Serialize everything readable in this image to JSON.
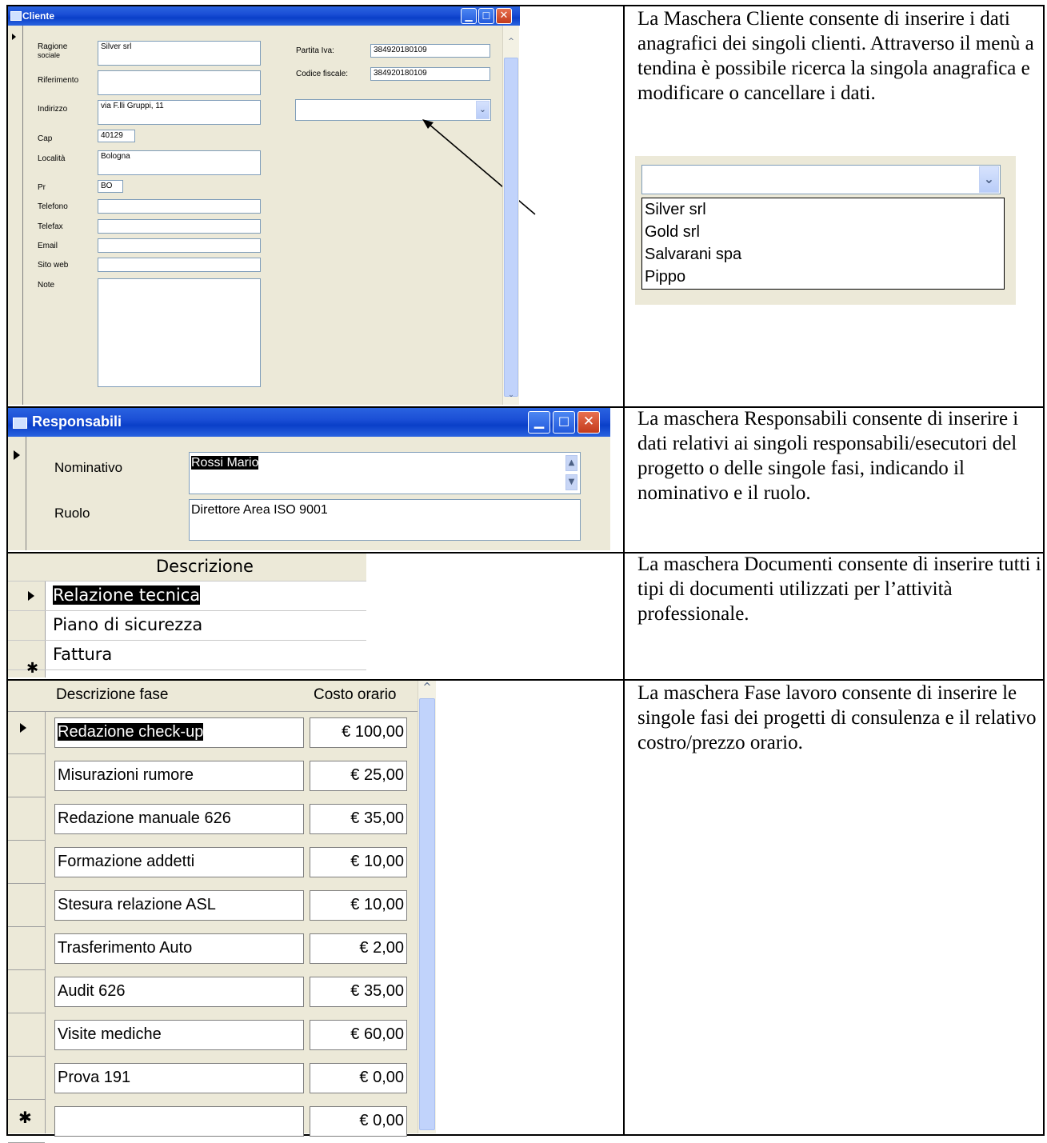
{
  "cliente": {
    "title": "Cliente",
    "labels": {
      "ragione_sociale_1": "Ragione",
      "ragione_sociale_2": "sociale",
      "riferimento": "Riferimento",
      "indirizzo": "Indirizzo",
      "cap": "Cap",
      "localita": "Località",
      "pr": "Pr",
      "telefono": "Telefono",
      "telefax": "Telefax",
      "email": "Email",
      "sito_web": "Sito web",
      "note": "Note",
      "partita_iva": "Partita Iva:",
      "codice_fiscale": "Codice fiscale:"
    },
    "values": {
      "ragione_sociale": "Silver srl",
      "riferimento": "",
      "indirizzo": "via F.lli Gruppi, 11",
      "cap": "40129",
      "localita": "Bologna",
      "pr": "BO",
      "telefono": "",
      "telefax": "",
      "email": "",
      "sito_web": "",
      "note": "",
      "partita_iva": "384920180109",
      "codice_fiscale": "384920180109",
      "search": ""
    },
    "description": "La Maschera Cliente consente di inserire i dati anagrafici dei singoli clienti. Attraverso il menù a tendina è possibile ricerca la singola anagrafica e modificare o cancellare i dati.",
    "dropdown": {
      "value": "",
      "options": [
        "Silver srl",
        "Gold srl",
        "Salvarani spa",
        "Pippo"
      ]
    }
  },
  "responsabili": {
    "title": "Responsabili",
    "labels": {
      "nominativo": "Nominativo",
      "ruolo": "Ruolo"
    },
    "values": {
      "nominativo": "Rossi Mario",
      "ruolo": "Direttore Area ISO 9001"
    },
    "description": "La maschera Responsabili consente di inserire i dati relativi ai singoli responsabili/esecutori del progetto o delle singole fasi, indicando il nominativo e il ruolo."
  },
  "documenti": {
    "header": "Descrizione",
    "rows": [
      "Relazione tecnica",
      "Piano di sicurezza",
      "Fattura"
    ],
    "new_row_marker": "✱",
    "description": "La maschera Documenti consente di inserire tutti i tipi di documenti utilizzati per l’attività professionale."
  },
  "fasi": {
    "headers": {
      "descrizione": "Descrizione fase",
      "costo": "Costo orario"
    },
    "rows": [
      {
        "descrizione": "Redazione check-up",
        "costo": "€ 100,00"
      },
      {
        "descrizione": "Misurazioni rumore",
        "costo": "€ 25,00"
      },
      {
        "descrizione": "Redazione manuale 626",
        "costo": "€ 35,00"
      },
      {
        "descrizione": "Formazione addetti",
        "costo": "€ 10,00"
      },
      {
        "descrizione": "Stesura relazione ASL",
        "costo": "€ 10,00"
      },
      {
        "descrizione": "Trasferimento Auto",
        "costo": "€ 2,00"
      },
      {
        "descrizione": "Audit 626",
        "costo": "€ 35,00"
      },
      {
        "descrizione": "Visite mediche",
        "costo": "€ 60,00"
      },
      {
        "descrizione": "Prova 191",
        "costo": "€ 0,00"
      }
    ],
    "new_row": {
      "descrizione": "",
      "costo": "€ 0,00"
    },
    "new_row_marker": "✱",
    "description": "La maschera Fase lavoro consente di inserire le singole fasi dei progetti di consulenza e il relativo costro/prezzo orario."
  },
  "colors": {
    "titlebar": "#0a3fc8",
    "form_bg": "#ece9d8",
    "field_border": "#7f9db9"
  },
  "icons": [
    "form-icon",
    "minimize-icon",
    "maximize-icon",
    "close-icon",
    "record-selector-icon",
    "chevron-down-icon",
    "new-record-icon",
    "arrow-annotation-icon"
  ]
}
